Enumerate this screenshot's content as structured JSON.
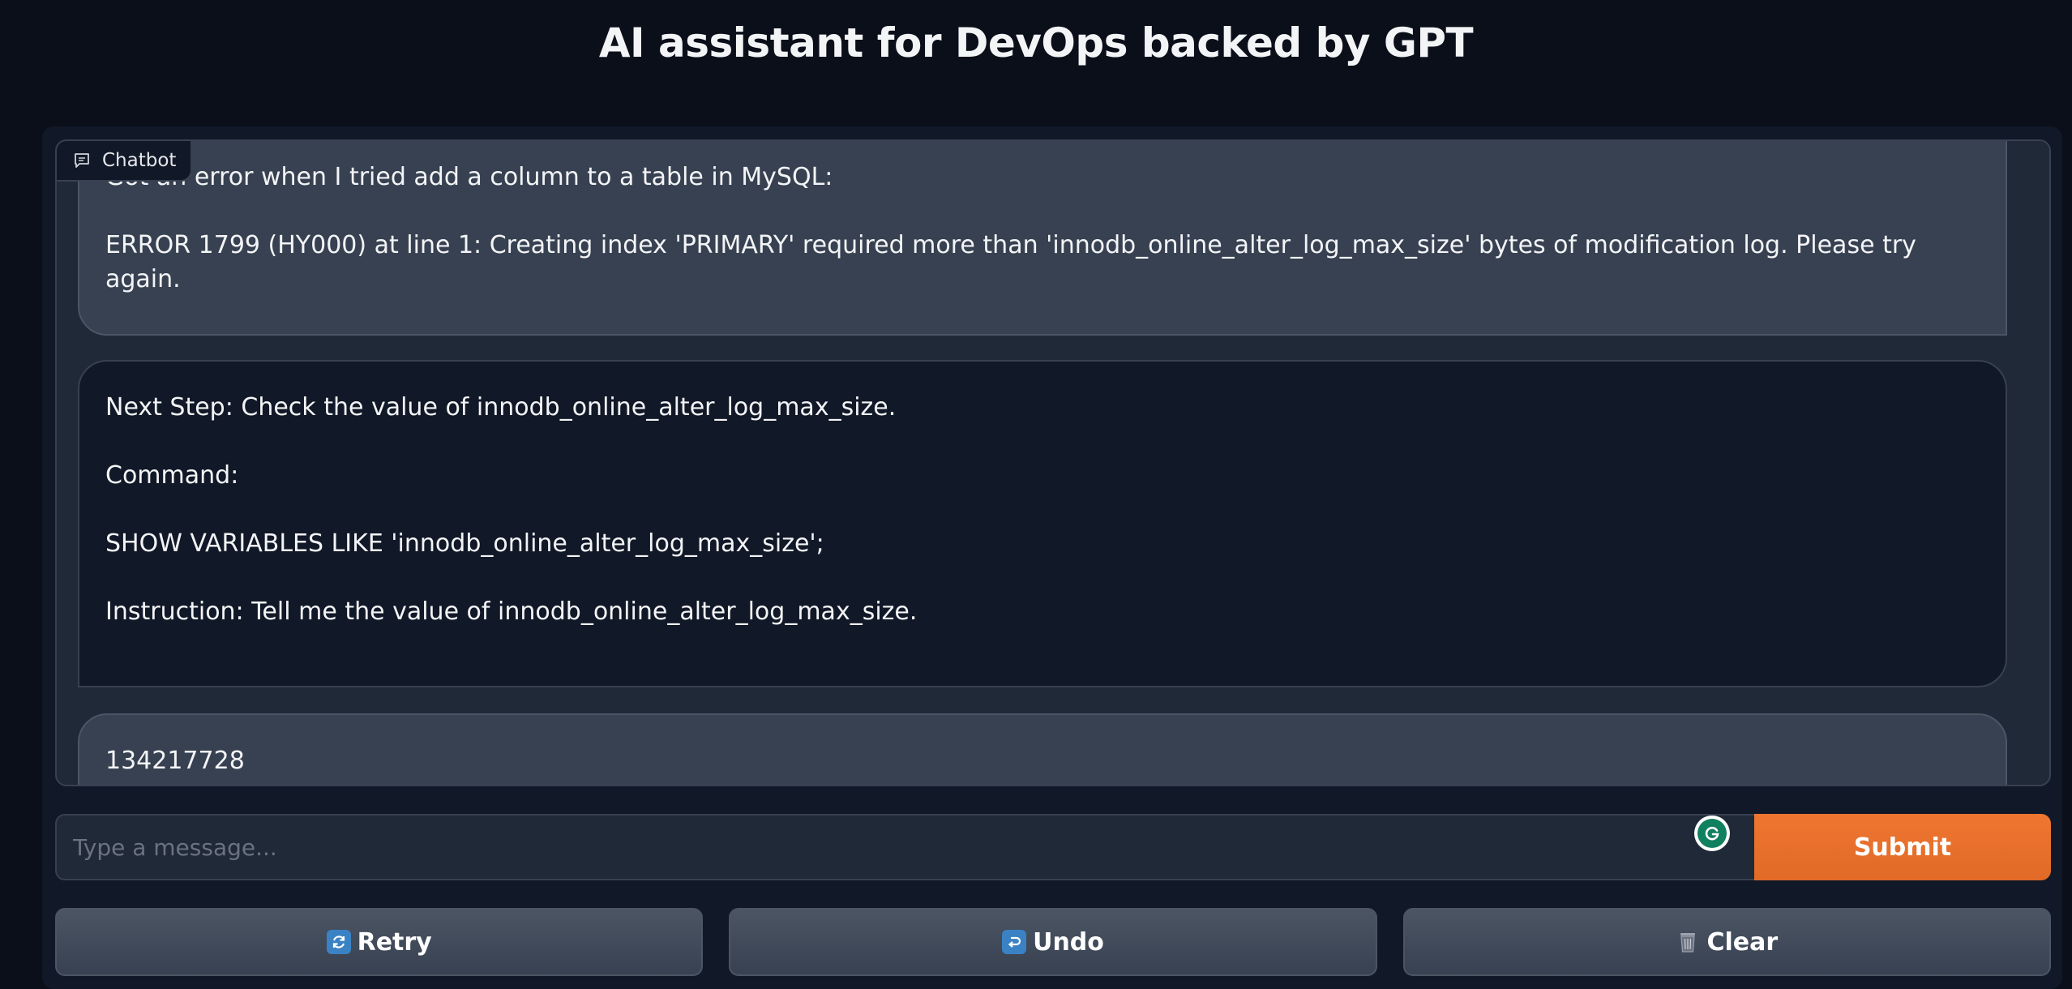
{
  "header": {
    "title": "AI assistant for DevOps backed by GPT"
  },
  "chatbot": {
    "label": "Chatbot",
    "icon": "chat-bubble-icon",
    "messages": [
      {
        "role": "user",
        "lines": [
          "Got an error when I tried add a column to a table in MySQL:",
          "ERROR 1799 (HY000) at line 1: Creating index 'PRIMARY' required more than 'innodb_online_alter_log_max_size' bytes of modification log. Please try again."
        ]
      },
      {
        "role": "bot",
        "lines": [
          "Next Step: Check the value of innodb_online_alter_log_max_size.",
          "Command:",
          "SHOW VARIABLES LIKE 'innodb_online_alter_log_max_size';",
          "Instruction: Tell me the value of innodb_online_alter_log_max_size."
        ]
      },
      {
        "role": "user",
        "lines": [
          "134217728"
        ]
      }
    ]
  },
  "input": {
    "placeholder": "Type a message...",
    "value": ""
  },
  "buttons": {
    "submit": "Submit",
    "retry": "Retry",
    "undo": "Undo",
    "clear": "Clear"
  },
  "colors": {
    "background": "#0b0f19",
    "panel": "#111827",
    "user_bubble": "#374151",
    "bot_bubble": "#111827",
    "submit": "#e8712d",
    "secondary_button": "#4b5563"
  }
}
